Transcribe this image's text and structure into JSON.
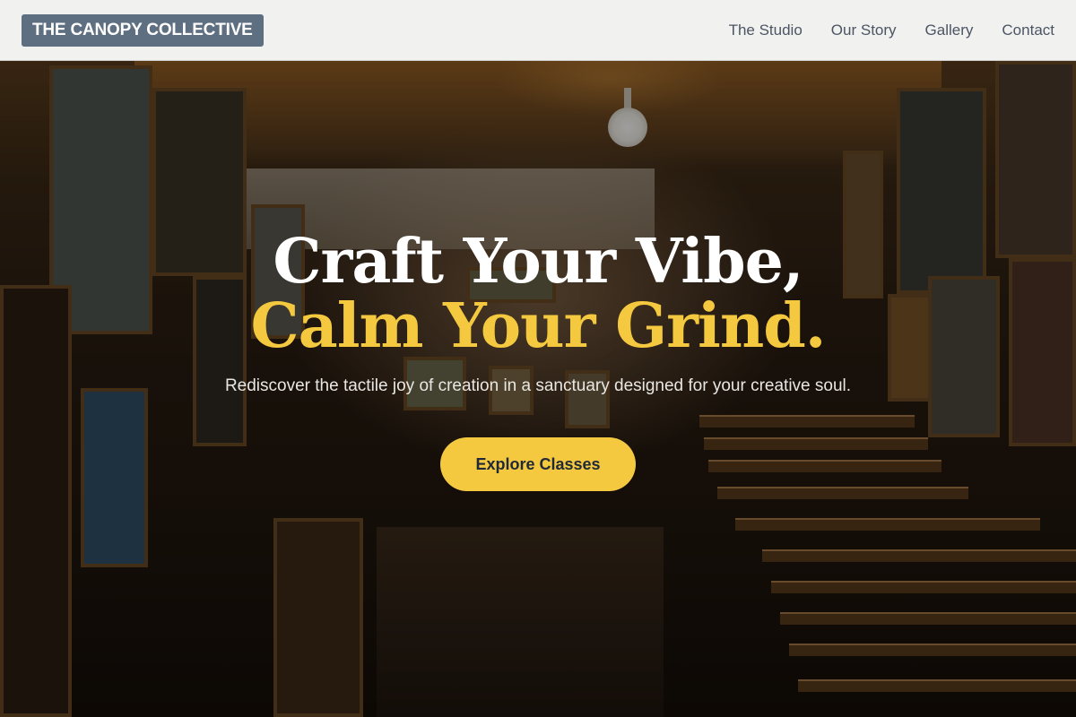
{
  "header": {
    "logo": "THE CANOPY COLLECTIVE",
    "nav": [
      {
        "label": "The Studio"
      },
      {
        "label": "Our Story"
      },
      {
        "label": "Gallery"
      },
      {
        "label": "Contact"
      }
    ]
  },
  "hero": {
    "headline_line1": "Craft Your Vibe,",
    "headline_line2": "Calm Your Grind.",
    "subtitle": "Rediscover the tactile joy of creation in a sanctuary designed for your creative soul.",
    "cta_label": "Explore Classes",
    "background_image": "art-studio-gallery-photo"
  },
  "colors": {
    "accent": "#f4c93f",
    "logo_bg": "#5f6f82",
    "header_bg": "#f1f1f0",
    "nav_text": "#4b5563"
  }
}
